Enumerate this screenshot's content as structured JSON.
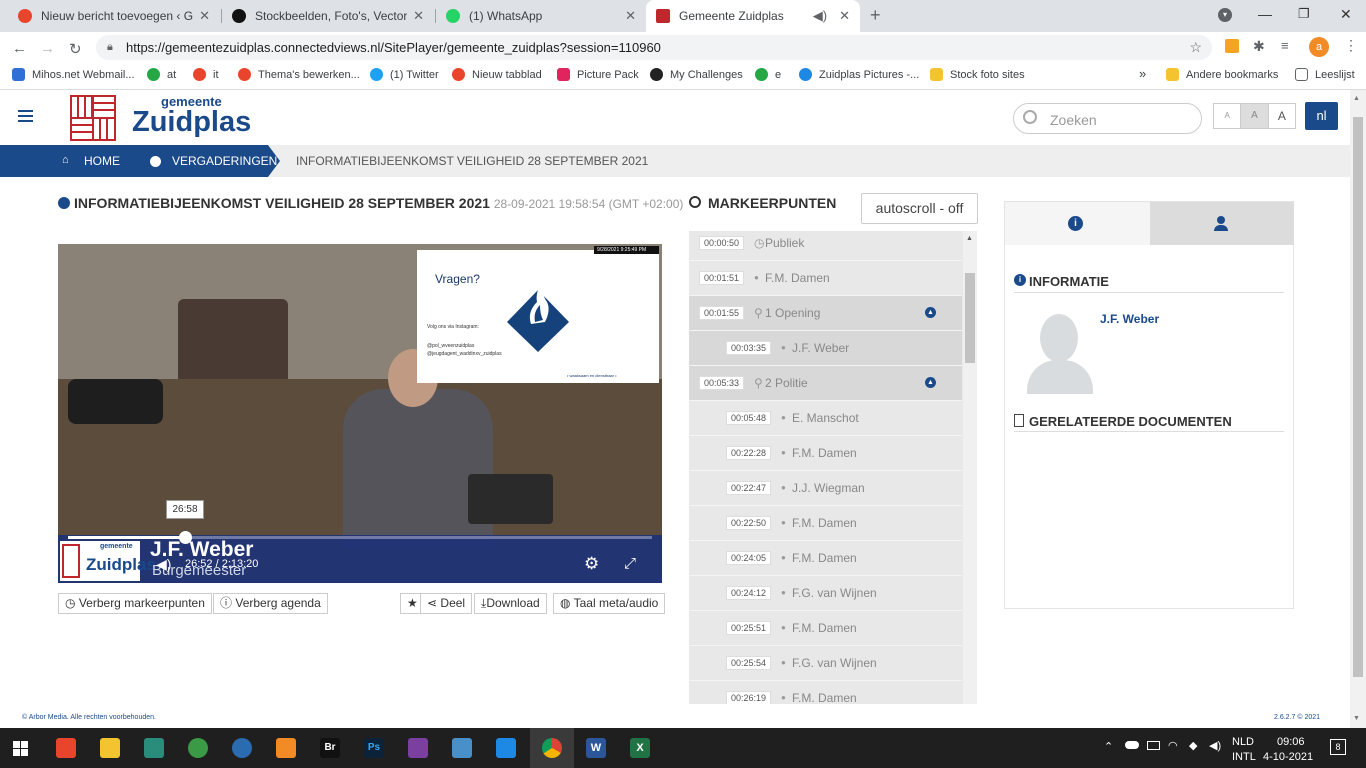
{
  "browser": {
    "tabs": [
      {
        "title": "Nieuw bericht toevoegen ‹ Gouw",
        "active": false,
        "color": "#e8452c"
      },
      {
        "title": "Stockbeelden, Foto's, Vectors, Illu",
        "active": false,
        "color": "#111111"
      },
      {
        "title": "(1) WhatsApp",
        "active": false,
        "color": "#25d366"
      },
      {
        "title": "Gemeente Zuidplas",
        "active": true,
        "color": "#c0272d"
      }
    ],
    "url": "https://gemeentezuidplas.connectedviews.nl/SitePlayer/gemeente_zuidplas?session=110960",
    "bookmarks": [
      {
        "label": "Mihos.net Webmail...",
        "color": "#2f6fd6"
      },
      {
        "label": "at",
        "color": "#25a745"
      },
      {
        "label": "it",
        "color": "#e8452c"
      },
      {
        "label": "Thema's bewerken...",
        "color": "#e8452c"
      },
      {
        "label": "(1) Twitter",
        "color": "#1da1f2"
      },
      {
        "label": "Nieuw tabblad",
        "color": "#e8452c"
      },
      {
        "label": "Picture Pack",
        "color": "#e0245e"
      },
      {
        "label": "My Challenges",
        "color": "#222222"
      },
      {
        "label": "e",
        "color": "#25a745"
      },
      {
        "label": "Zuidplas Pictures -...",
        "color": "#1e88e5"
      },
      {
        "label": "Stock foto sites",
        "color": "#f4c430"
      }
    ],
    "bookmarks_more": "»",
    "other_bookmarks": "Andere bookmarks",
    "reading_list": "Leeslijst",
    "profile_initial": "a"
  },
  "site": {
    "logo_small": "gemeente",
    "logo_big": "Zuidplas",
    "search_placeholder": "Zoeken",
    "font_sizes": [
      "A",
      "A",
      "A"
    ],
    "language": "nl",
    "breadcrumb": {
      "home": "HOME",
      "meetings": "VERGADERINGEN",
      "current": "INFORMATIEBIJEENKOMST VEILIGHEID 28 SEPTEMBER 2021"
    },
    "meeting": {
      "title": "INFORMATIEBIJEENKOMST VEILIGHEID 28 SEPTEMBER 2021",
      "datetime": "28-09-2021 19:58:54 (GMT +02:00)"
    },
    "video": {
      "slide_title": "Vragen?",
      "slide_follow": "Volg ons via Instagram:",
      "slide_handles": [
        "@pol_wveenzuidplas",
        "@jeugdagent_waddinxv_zuidplas"
      ],
      "slide_footer": "• waaksaam en dienstbaar •",
      "overlay_stamp": "9/28/2021  9:25:49 PM",
      "caption_name": "J.F. Weber",
      "caption_role": "Burgemeester",
      "caption_logo_small": "gemeente",
      "caption_logo_big": "Zuidplas",
      "tooltip_time": "26:58",
      "current_time": "26:52",
      "separator": "/",
      "duration": "2:13:20",
      "progress_fraction": 0.2
    },
    "under_video_left": [
      "Verberg markeerpunten",
      "Verberg agenda"
    ],
    "under_video_right": [
      "Deel",
      "Download",
      "Taal meta/audio"
    ],
    "markers": {
      "title": "MARKEERPUNTEN",
      "autoscroll": "autoscroll - off",
      "items": [
        {
          "time": "00:00:50",
          "name": "Publiek",
          "level": 0,
          "kind": "clock"
        },
        {
          "time": "00:01:51",
          "name": "F.M. Damen",
          "level": 0,
          "kind": "person"
        },
        {
          "time": "00:01:55",
          "name": "1 Opening",
          "level": 0,
          "kind": "agenda",
          "hl": true
        },
        {
          "time": "00:03:35",
          "name": "J.F. Weber",
          "level": 1,
          "kind": "person",
          "hl": true
        },
        {
          "time": "00:05:33",
          "name": "2 Politie",
          "level": 0,
          "kind": "agenda",
          "hl": true
        },
        {
          "time": "00:05:48",
          "name": "E. Manschot",
          "level": 1,
          "kind": "person"
        },
        {
          "time": "00:22:28",
          "name": "F.M. Damen",
          "level": 1,
          "kind": "person"
        },
        {
          "time": "00:22:47",
          "name": "J.J. Wiegman",
          "level": 1,
          "kind": "person"
        },
        {
          "time": "00:22:50",
          "name": "F.M. Damen",
          "level": 1,
          "kind": "person"
        },
        {
          "time": "00:24:05",
          "name": "F.M. Damen",
          "level": 1,
          "kind": "person"
        },
        {
          "time": "00:24:12",
          "name": "F.G. van Wijnen",
          "level": 1,
          "kind": "person"
        },
        {
          "time": "00:25:51",
          "name": "F.M. Damen",
          "level": 1,
          "kind": "person"
        },
        {
          "time": "00:25:54",
          "name": "F.G. van Wijnen",
          "level": 1,
          "kind": "person"
        },
        {
          "time": "00:26:19",
          "name": "F.M. Damen",
          "level": 1,
          "kind": "person"
        }
      ]
    },
    "info": {
      "title": "INFORMATIE",
      "person": "J.F. Weber",
      "docs_title": "GERELATEERDE DOCUMENTEN"
    },
    "footer_left": "© Arbor Media. Alle rechten voorbehouden.",
    "footer_right": "2.6.2.7 © 2021"
  },
  "taskbar": {
    "lang1": "NLD",
    "lang2": "INTL",
    "time": "09:06",
    "date": "4-10-2021",
    "notifications": "8"
  },
  "colors": {
    "brand_blue": "#1a4a8a",
    "brand_red": "#c0272d"
  }
}
